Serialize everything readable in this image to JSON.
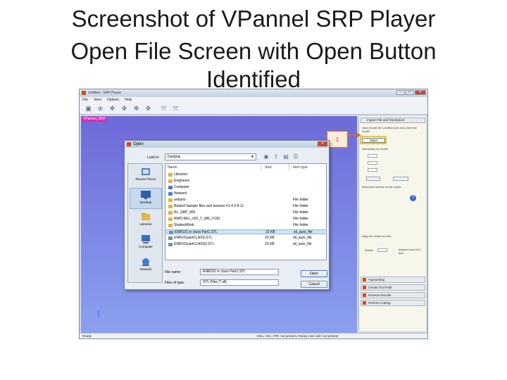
{
  "slide": {
    "title_line1": "Screenshot of VPannel SRP Player",
    "title_line2": "Open File Screen with Open Button",
    "title_line3": "Identified"
  },
  "app": {
    "title": "Untitled - SRP Player",
    "menu": [
      "File",
      "View",
      "Options",
      "Help"
    ],
    "toolbar_icons": [
      "save-icon",
      "globe-icon",
      "move-icon",
      "move-icon",
      "move-icon",
      "move-icon",
      "fit-icon",
      "fit-icon"
    ],
    "viewport_tag": "VPannel_SRP",
    "axis_z": "Z",
    "axis_x": "X",
    "status_left": "Ready",
    "status_right": "MILL: N/A, ATR: not present, Rotary Axis Unit: not present"
  },
  "panel": {
    "header": "Import File and Orientation",
    "instruction": "Open model file, position size and orient the model",
    "open_label": "Open",
    "size_text": "Size/scale the model",
    "orientation_text": "Select the surface of the model...",
    "align_text": "Align the model so that...",
    "rotate_label": "Rotate",
    "degrees_text": "degrees around Z axis",
    "nav_items": [
      "Typesetting",
      "Create Tool Path",
      "Preview Results",
      "Perform Cutting"
    ]
  },
  "callout": {
    "number": "1",
    "color": "#e26b2a",
    "highlight_color": "#f2c81b"
  },
  "dialog": {
    "title": "Open",
    "close_label": "✕",
    "lookin_label": "Look in:",
    "lookin_value": "Desktop",
    "places": [
      "Recent Places",
      "Desktop",
      "Libraries",
      "Computer",
      "Network"
    ],
    "columns": [
      "Name",
      "Size",
      "Item type"
    ],
    "rows": [
      {
        "name": "Libraries",
        "size": "",
        "type": "",
        "selected": false
      },
      {
        "name": "Engineers",
        "size": "",
        "type": "",
        "selected": false
      },
      {
        "name": "Computer",
        "size": "",
        "type": "",
        "selected": false
      },
      {
        "name": "Network",
        "size": "",
        "type": "",
        "selected": false
      },
      {
        "name": "arduino",
        "size": "",
        "type": "File folder",
        "selected": false
      },
      {
        "name": "Roland Sample files and lessons #1-4 6 8-11",
        "size": "",
        "type": "File folder",
        "selected": false
      },
      {
        "name": "RL_SRP_WS",
        "size": "",
        "type": "File folder",
        "selected": false
      },
      {
        "name": "RWD-REL_r5D_T_x86_V130",
        "size": "",
        "type": "File folder",
        "selected": false
      },
      {
        "name": "StudentWork",
        "size": "",
        "type": "File folder",
        "selected": false
      },
      {
        "name": "ENR101 in class Part1.STL",
        "size": "22 KB",
        "type": "stl_auto_file",
        "selected": true
      },
      {
        "name": "ENR101partCLASS.STL",
        "size": "23 KB",
        "type": "stl_auto_file",
        "selected": false
      },
      {
        "name": "ENR101partCLASS2.STL",
        "size": "23 KB",
        "type": "stl_auto_file",
        "selected": false
      }
    ],
    "filename_label": "File name:",
    "filename_value": "ENR101 in class Part1.STL",
    "filetype_label": "Files of type:",
    "filetype_value": "STL Files (*.stl)",
    "open_button": "Open",
    "cancel_button": "Cancel"
  }
}
